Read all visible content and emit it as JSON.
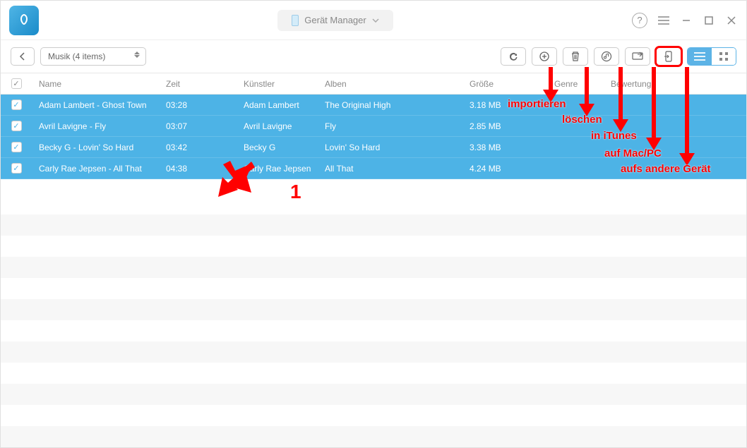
{
  "title": {
    "label": "Gerät Manager"
  },
  "breadcrumb": {
    "label": "Musik (4 items)"
  },
  "columns": {
    "name": "Name",
    "zeit": "Zeit",
    "artist": "Künstler",
    "alben": "Alben",
    "size": "Größe",
    "genre": "Genre",
    "rating": "Bewertung"
  },
  "rows": [
    {
      "name": "Adam Lambert - Ghost Town",
      "zeit": "03:28",
      "artist": "Adam Lambert",
      "alben": "The Original High",
      "size": "3.18 MB"
    },
    {
      "name": "Avril Lavigne - Fly",
      "zeit": "03:07",
      "artist": "Avril Lavigne",
      "alben": "Fly",
      "size": "2.85 MB"
    },
    {
      "name": "Becky G - Lovin' So Hard",
      "zeit": "03:42",
      "artist": "Becky G",
      "alben": "Lovin' So Hard",
      "size": "3.38 MB"
    },
    {
      "name": "Carly Rae Jepsen - All That",
      "zeit": "04:38",
      "artist": "Carly Rae Jepsen",
      "alben": "All That",
      "size": "4.24 MB"
    }
  ],
  "annotations": {
    "import": "importieren",
    "delete": "löschen",
    "itunes": "in iTunes",
    "macpc": "auf Mac/PC",
    "other": "aufs andere Gerät",
    "step": "1"
  }
}
